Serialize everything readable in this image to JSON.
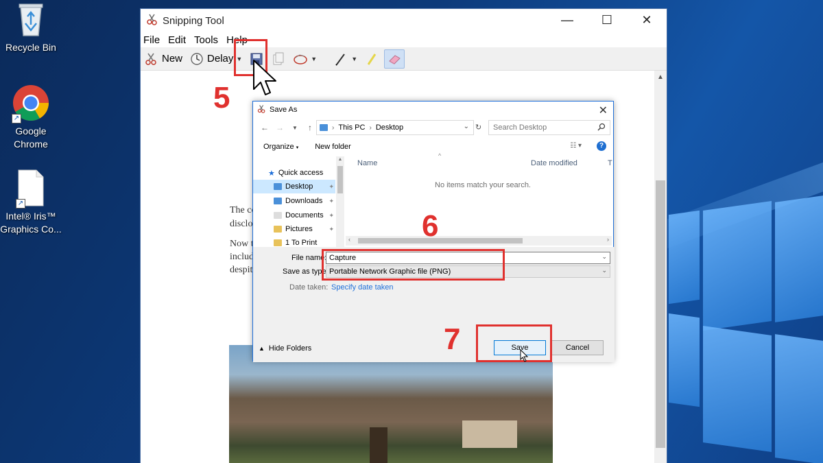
{
  "desktop": {
    "icons": [
      {
        "label": "Recycle Bin"
      },
      {
        "label": "Google\nChrome"
      },
      {
        "label": "Intel® Iris™\nGraphics Co..."
      }
    ]
  },
  "snip": {
    "title": "Snipping Tool",
    "menu": [
      "File",
      "Edit",
      "Tools",
      "Help"
    ],
    "toolbar": {
      "new_label": "New",
      "delay_label": "Delay"
    },
    "article_lines": [
      "The co",
      "disclo",
      "Now t",
      "includ",
      "despit"
    ]
  },
  "annotations": {
    "step5": "5",
    "step6": "6",
    "step7": "7"
  },
  "dialog": {
    "title": "Save As",
    "address": {
      "part1": "This PC",
      "part2": "Desktop"
    },
    "search_placeholder": "Search Desktop",
    "organize_label": "Organize",
    "new_folder_label": "New folder",
    "nav_items": [
      "Quick access",
      "Desktop",
      "Downloads",
      "Documents",
      "Pictures",
      "1 To Print"
    ],
    "columns": {
      "name": "Name",
      "date_modified": "Date modified",
      "type_partial": "T"
    },
    "empty_message": "No items match your search.",
    "file_name_label": "File name:",
    "file_name_value": "Capture",
    "save_type_label": "Save as type:",
    "save_type_value": "Portable Network Graphic file (PNG)",
    "date_taken_label": "Date taken:",
    "date_taken_link": "Specify date taken",
    "hide_folders_label": "Hide Folders",
    "save_label": "Save",
    "cancel_label": "Cancel"
  },
  "colors": {
    "annotation_red": "#e0312e",
    "accent_blue": "#1e6fd9"
  }
}
